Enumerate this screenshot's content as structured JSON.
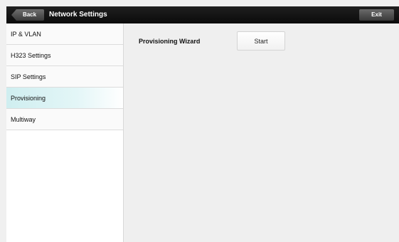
{
  "header": {
    "back_label": "Back",
    "title": "Network Settings",
    "exit_label": "Exit"
  },
  "sidebar": {
    "items": [
      {
        "label": "IP & VLAN",
        "active": false
      },
      {
        "label": "H323 Settings",
        "active": false
      },
      {
        "label": "SIP Settings",
        "active": false
      },
      {
        "label": "Provisioning",
        "active": true
      },
      {
        "label": "Multiway",
        "active": false
      }
    ]
  },
  "main": {
    "provisioning_label": "Provisioning Wizard",
    "start_label": "Start"
  },
  "colors": {
    "topbar": "#111111",
    "active_item": "#d6f1f3",
    "background": "#efefef"
  }
}
